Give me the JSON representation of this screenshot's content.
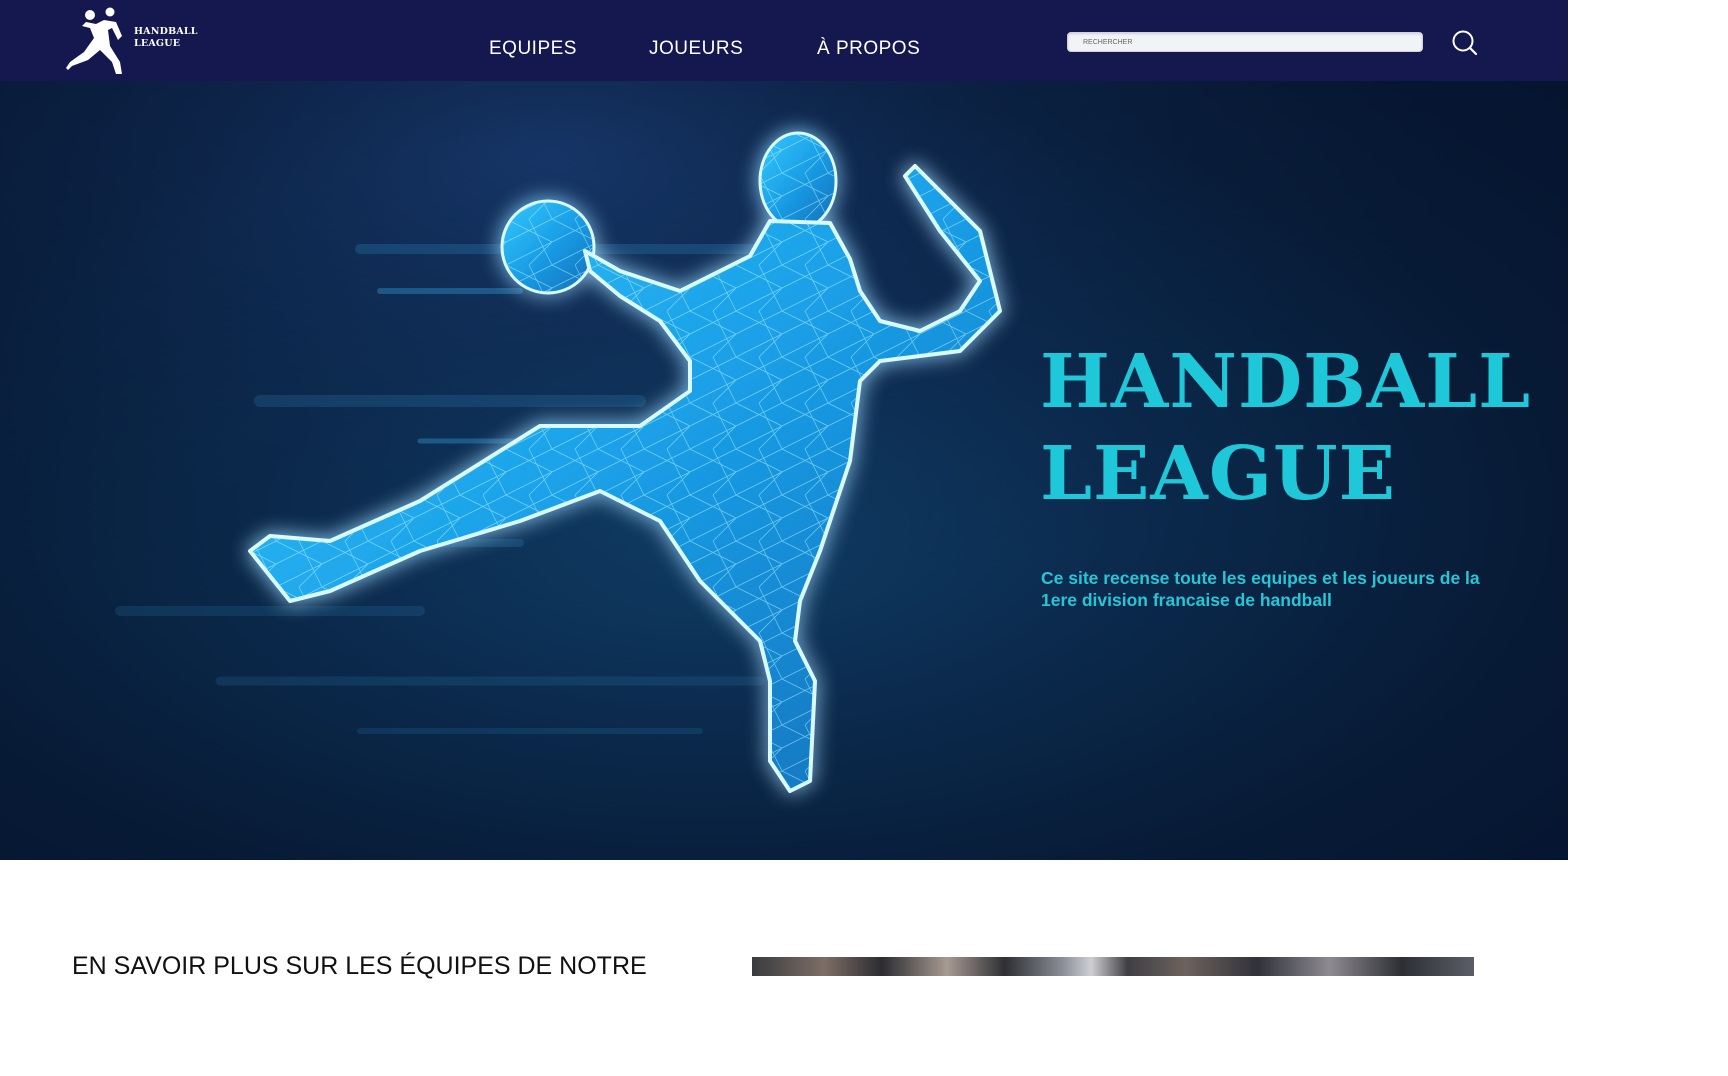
{
  "header": {
    "logo_text": "HANDBALL\nLEAGUE",
    "nav": [
      "EQUIPES",
      "JOUEURS",
      "À PROPOS"
    ],
    "search": {
      "placeholder": "RECHERCHER",
      "value": ""
    },
    "search_icon": "search-icon",
    "background_color": "#15184f"
  },
  "hero": {
    "title": "HANDBALL\nLEAGUE",
    "subtitle": "Ce site recense toute les equipes et les joueurs de la 1ere division francaise de handball",
    "accent_color": "#1ec8d8",
    "image": "glowing-handball-player"
  },
  "section": {
    "title": "EN SAVOIR PLUS SUR LES ÉQUIPES DE NOTRE",
    "image": "handball-match-photo"
  }
}
